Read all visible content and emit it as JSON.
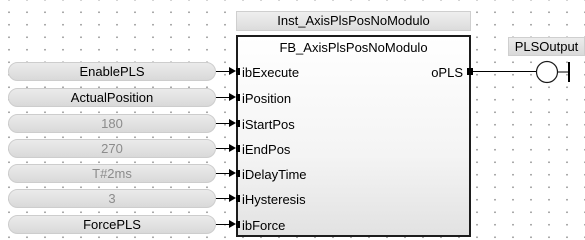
{
  "instance_name": "Inst_AxisPlsPosNoModulo",
  "block_type": "FB_AxisPlsPosNoModulo",
  "inputs": [
    {
      "value": "EnablePLS",
      "kind": "var",
      "pin": "ibExecute"
    },
    {
      "value": "ActualPosition",
      "kind": "var",
      "pin": "iPosition"
    },
    {
      "value": "180",
      "kind": "const",
      "pin": "iStartPos"
    },
    {
      "value": "270",
      "kind": "const",
      "pin": "iEndPos"
    },
    {
      "value": "T#2ms",
      "kind": "const",
      "pin": "iDelayTime"
    },
    {
      "value": "3",
      "kind": "const",
      "pin": "iHysteresis"
    },
    {
      "value": "ForcePLS",
      "kind": "var",
      "pin": "ibForce"
    }
  ],
  "output_pin": "oPLS",
  "coil": {
    "name": "PLSOutput",
    "type": "coil"
  },
  "colors": {
    "constant_text": "#8c8c8c",
    "block_border": "#1c1c1c"
  }
}
